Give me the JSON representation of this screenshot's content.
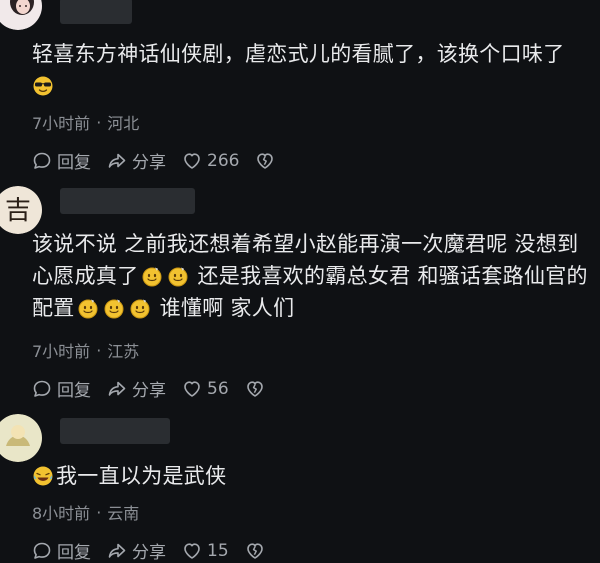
{
  "comments": [
    {
      "text_parts": [
        "轻喜东方神话仙侠剧，虐恋式儿的看腻了，该换个口味了"
      ],
      "time": "7小时前",
      "sep": "·",
      "location": "河北",
      "reply_label": "回复",
      "share_label": "分享",
      "likes": "266"
    },
    {
      "text_parts": [
        "该说不说 之前我还想着希望小赵能再演一次魔君呢 没想到心愿成真了",
        "还是我喜欢的霸总女君 和骚话套路仙官的配置",
        "谁懂啊 家人们"
      ],
      "time": "7小时前",
      "sep": "·",
      "location": "江苏",
      "reply_label": "回复",
      "share_label": "分享",
      "likes": "56"
    },
    {
      "text_parts": [
        "我一直以为是武侠"
      ],
      "time": "8小时前",
      "sep": "·",
      "location": "云南",
      "reply_label": "回复",
      "share_label": "分享",
      "likes": "15"
    }
  ],
  "colors": {
    "background": "#0f1114",
    "text": "#e9eaec",
    "meta": "#8b8f95",
    "actions": "#a4a8ae"
  },
  "icons": {
    "reply": "comment-bubble-icon",
    "share": "share-arrow-icon",
    "like": "heart-icon",
    "dislike": "broken-heart-icon",
    "emoji_sunglasses": "sunglasses-emoji-icon",
    "emoji_smile": "smile-emoji-icon",
    "emoji_lol": "laughing-tears-emoji-icon"
  }
}
